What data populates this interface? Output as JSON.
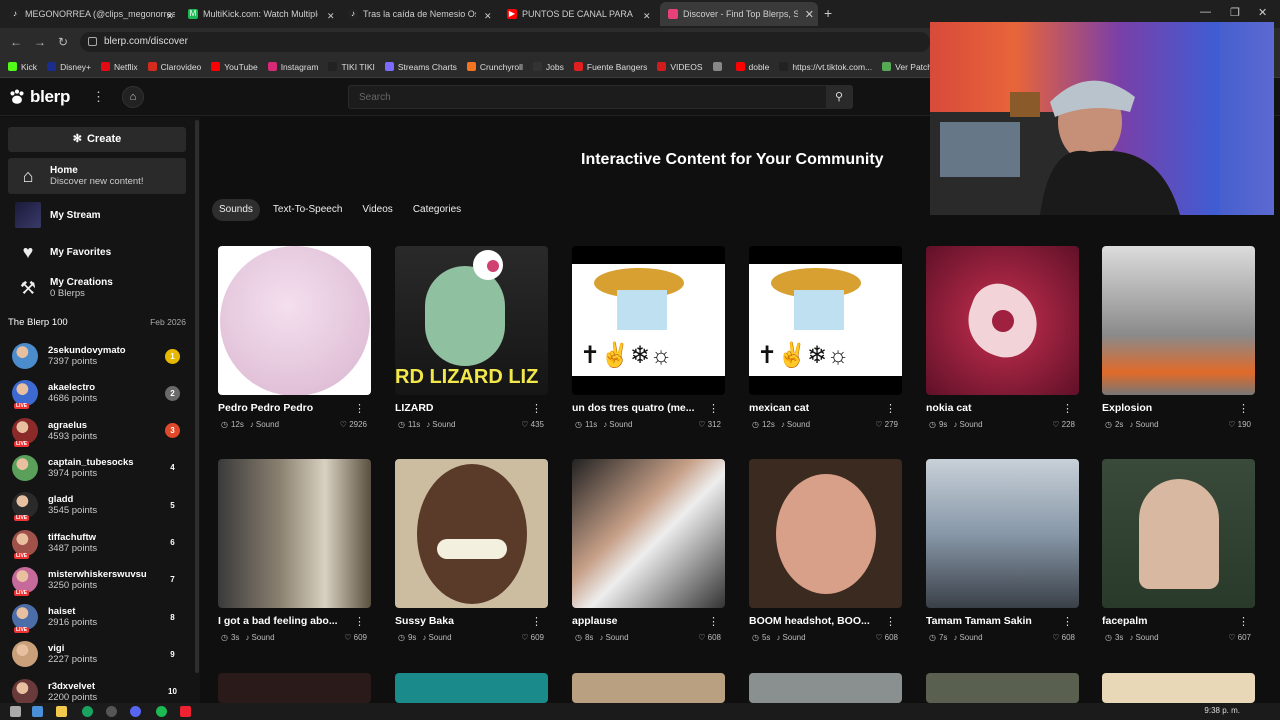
{
  "browser": {
    "tabs": [
      {
        "label": "MEGONORREA (@clips_megonorrea",
        "icon_color": "#222222",
        "icon": "tiktok-icon"
      },
      {
        "label": "MultiKick.com: Watch Multiple Kick",
        "icon_color": "#1db954",
        "icon": "multikick-icon"
      },
      {
        "label": "Tras la caída de Nemesio Oseguera",
        "icon_color": "#222222",
        "icon": "tiktok-icon"
      },
      {
        "label": "PUNTOS DE CANAL PARA KICK",
        "icon_color": "#ff0000",
        "icon": "youtube-icon"
      },
      {
        "label": "Discover - Find Top Blerps, Streaming",
        "icon_color": "#e8407a",
        "icon": "blerp-icon"
      }
    ],
    "url": "blerp.com/discover"
  },
  "bookmarks": [
    {
      "label": "Kick",
      "color": "#53fc18"
    },
    {
      "label": "Disney+",
      "color": "#1a2c8c"
    },
    {
      "label": "Netflix",
      "color": "#e50914"
    },
    {
      "label": "Clarovideo",
      "color": "#d52b1e"
    },
    {
      "label": "YouTube",
      "color": "#ff0000"
    },
    {
      "label": "Instagram",
      "color": "#d62976"
    },
    {
      "label": "TIKI TIKI",
      "color": "#222222"
    },
    {
      "label": "Streams Charts",
      "color": "#7b6cff"
    },
    {
      "label": "Crunchyroll",
      "color": "#f47521"
    },
    {
      "label": "Jobs",
      "color": "#333333"
    },
    {
      "label": "Fuente Bangers",
      "color": "#e02020"
    },
    {
      "label": "VIDEOS",
      "color": "#d01c1c"
    },
    {
      "label": "",
      "color": "#888888"
    },
    {
      "label": "doble",
      "color": "#ff0000"
    },
    {
      "label": "https://vt.tiktok.com...",
      "color": "#222222"
    },
    {
      "label": "Ver Patch Ad",
      "color": "#55aa55"
    }
  ],
  "header": {
    "logo": "blerp",
    "search_placeholder": "Search"
  },
  "sidebar": {
    "create_label": "Create",
    "nav": [
      {
        "title": "Home",
        "sub": "Discover new content!",
        "icon": "home-icon"
      },
      {
        "title": "My Stream",
        "sub": "",
        "icon": "stream-icon"
      },
      {
        "title": "My Favorites",
        "sub": "",
        "icon": "heart-icon"
      },
      {
        "title": "My Creations",
        "sub": "0 Blerps",
        "icon": "hammer-icon"
      }
    ],
    "blerp100_title": "The Blerp 100",
    "blerp100_date": "Feb 2026",
    "leaderboard": [
      {
        "name": "2sekundovymato",
        "points": "7397 points",
        "rank": "1",
        "live": false,
        "avatar_color": "#4a8ccc"
      },
      {
        "name": "akaelectro",
        "points": "4686 points",
        "rank": "2",
        "live": true,
        "avatar_color": "#3d6ad0"
      },
      {
        "name": "agraelus",
        "points": "4593 points",
        "rank": "3",
        "live": true,
        "avatar_color": "#8c2a2a"
      },
      {
        "name": "captain_tubesocks",
        "points": "3974 points",
        "rank": "4",
        "live": false,
        "avatar_color": "#5aa05a"
      },
      {
        "name": "gladd",
        "points": "3545 points",
        "rank": "5",
        "live": true,
        "avatar_color": "#2a2a2a"
      },
      {
        "name": "tiffachuftw",
        "points": "3487 points",
        "rank": "6",
        "live": true,
        "avatar_color": "#a0524a"
      },
      {
        "name": "misterwhiskerswuvsu",
        "points": "3250 points",
        "rank": "7",
        "live": true,
        "avatar_color": "#c56a9a"
      },
      {
        "name": "haiset",
        "points": "2916 points",
        "rank": "8",
        "live": true,
        "avatar_color": "#4c6ea8"
      },
      {
        "name": "vigi",
        "points": "2227 points",
        "rank": "9",
        "live": false,
        "avatar_color": "#c9a07a"
      },
      {
        "name": "r3dxvelvet",
        "points": "2200 points",
        "rank": "10",
        "live": false,
        "avatar_color": "#6a3a3a"
      }
    ]
  },
  "main": {
    "hero_title": "Interactive Content for Your Community",
    "tabs": [
      "Sounds",
      "Text-To-Speech",
      "Videos",
      "Categories"
    ],
    "row1": [
      {
        "title": "Pedro Pedro Pedro",
        "duration": "12s",
        "type": "Sound",
        "likes": "2926"
      },
      {
        "title": "LIZARD",
        "duration": "11s",
        "type": "Sound",
        "likes": "435"
      },
      {
        "title": "un dos tres quatro (me...",
        "duration": "11s",
        "type": "Sound",
        "likes": "312"
      },
      {
        "title": "mexican cat",
        "duration": "12s",
        "type": "Sound",
        "likes": "279"
      },
      {
        "title": "nokia cat",
        "duration": "9s",
        "type": "Sound",
        "likes": "228"
      },
      {
        "title": "Explosion",
        "duration": "2s",
        "type": "Sound",
        "likes": "190"
      }
    ],
    "row2": [
      {
        "title": "I got a bad feeling abo...",
        "duration": "3s",
        "type": "Sound",
        "likes": "609"
      },
      {
        "title": "Sussy Baka",
        "duration": "9s",
        "type": "Sound",
        "likes": "609"
      },
      {
        "title": "applause",
        "duration": "8s",
        "type": "Sound",
        "likes": "608"
      },
      {
        "title": "BOOM headshot, BOO...",
        "duration": "5s",
        "type": "Sound",
        "likes": "608"
      },
      {
        "title": "Tamam Tamam Sakin",
        "duration": "7s",
        "type": "Sound",
        "likes": "608"
      },
      {
        "title": "facepalm",
        "duration": "3s",
        "type": "Sound",
        "likes": "607"
      }
    ],
    "lizard_banner": "RD LIZARD LIZ"
  },
  "taskbar": {
    "clock": "9:38 p. m."
  }
}
